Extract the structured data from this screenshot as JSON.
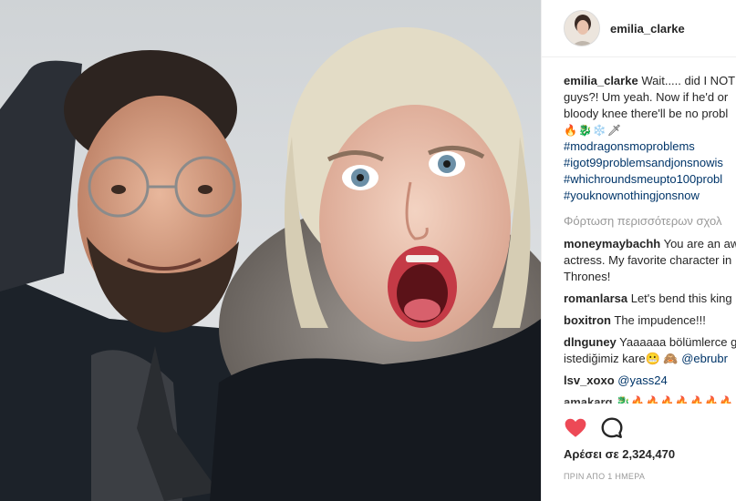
{
  "post": {
    "username": "emilia_clarke",
    "caption_lines": [
      "Wait..... did I NOT",
      "guys?! Um yeah. Now if he'd or",
      "bloody knee there'll be no probl"
    ],
    "caption_emojis": "🔥🐉❄️🗡",
    "hashtags": [
      "#modragonsmoproblems",
      "#igot99problemsandjonsnowis",
      "#whichroundsmeupto100probl",
      "#youknownothingjonsnow"
    ],
    "load_more_label": "Φόρτωση περισσότερων σχολ",
    "comments": [
      {
        "user": "moneymaybachh",
        "lines": [
          "You are an aw",
          "actress. My favorite character in",
          "Thrones!"
        ]
      },
      {
        "user": "romanlarsa",
        "lines": [
          "Let's bend this king"
        ]
      },
      {
        "user": "boxitron",
        "lines": [
          "The impudence!!!"
        ]
      },
      {
        "user": "dlnguney",
        "lines": [
          "Yaaaaaa bölümlerce g",
          "istediğimiz kare😬 🙈 "
        ],
        "mention": "@ebrubr"
      },
      {
        "user": "lsv_xoxo",
        "lines": [
          ""
        ],
        "mention": "@yass24"
      },
      {
        "user": "amakarg",
        "lines": [
          "🐉🔥🔥🔥🔥🔥🔥🔥🔥"
        ]
      }
    ],
    "likes_text": "Αρέσει σε 2,324,470",
    "time_text": "ΠΡΙΝ ΑΠΟ 1 ΗΜΕΡΑ"
  },
  "colors": {
    "like_red": "#ed4956",
    "link_blue": "#003569",
    "muted_gray": "#999999"
  },
  "icons": {
    "like": "heart-icon",
    "comment": "speech-bubble-icon"
  }
}
